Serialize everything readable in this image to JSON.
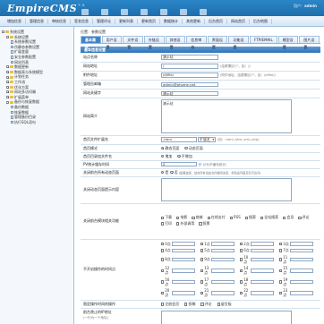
{
  "header": {
    "logo": "EmpireCMS",
    "logo_sup": "7.5",
    "user_label": "用户：",
    "user_name": "admin",
    "nav": [
      "系统",
      "栏目",
      "信息",
      "会员",
      "插件",
      "用户",
      "其他"
    ],
    "subnav": [
      "增加信息",
      "管理信息",
      "审核信息",
      "签发信息",
      "管理评论",
      "更新列表",
      "更新首页",
      "数据统计",
      "其他更新",
      "后台首页",
      "网站首页",
      "后台地图"
    ]
  },
  "sidebar": {
    "items": [
      {
        "label": "系统设置",
        "level": 0,
        "kind": "folder",
        "mark": "-"
      },
      {
        "label": "系统设置",
        "level": 1,
        "kind": "folder",
        "mark": "-"
      },
      {
        "label": "系统参数设置",
        "level": 2,
        "kind": "doc"
      },
      {
        "label": "伪静态参数设置",
        "level": 2,
        "kind": "doc"
      },
      {
        "label": "扩展变量",
        "level": 2,
        "kind": "doc"
      },
      {
        "label": "安全参数配置",
        "level": 2,
        "kind": "doc"
      },
      {
        "label": "网站列表",
        "level": 2,
        "kind": "doc"
      },
      {
        "label": "数据更新",
        "level": 1,
        "kind": "folder",
        "mark": "+"
      },
      {
        "label": "数据表与系统模型",
        "level": 1,
        "kind": "folder",
        "mark": "+"
      },
      {
        "label": "计划任务",
        "level": 1,
        "kind": "folder",
        "mark": "+"
      },
      {
        "label": "工作流",
        "level": 1,
        "kind": "folder",
        "mark": "+"
      },
      {
        "label": "优化方案",
        "level": 1,
        "kind": "folder",
        "mark": "+"
      },
      {
        "label": "网站多访问端",
        "level": 1,
        "kind": "folder",
        "mark": "+"
      },
      {
        "label": "扩展菜单",
        "level": 1,
        "kind": "folder",
        "mark": "+"
      },
      {
        "label": "备份与恢复数据",
        "level": 1,
        "kind": "folder",
        "mark": "-"
      },
      {
        "label": "备份数据",
        "level": 2,
        "kind": "doc"
      },
      {
        "label": "恢复数据",
        "level": 2,
        "kind": "doc"
      },
      {
        "label": "管理备份目录",
        "level": 2,
        "kind": "doc"
      },
      {
        "label": "执行SQL语句",
        "level": 2,
        "kind": "doc"
      }
    ]
  },
  "main": {
    "breadcrumb": "位置：参数设置",
    "tabs": [
      "基本属性",
      "用户设置",
      "文件设置",
      "外链设置",
      "其他设置",
      "信息审核",
      "界面设置",
      "功能设置",
      "FTP/EMAIL",
      "模型设置",
      "图片设置"
    ],
    "section_title": "基本信息设置",
    "fields": {
      "site_name_label": "站点名称",
      "site_name_value": "演示站",
      "site_url_label": "网站地址",
      "site_url_value": "/",
      "site_url_note": "(结尾需加\"/\"，如：/)",
      "attach_url_label": "附件地址",
      "attach_url_value": "/d/file/",
      "attach_url_note": "(附件地址，结尾需加\"/\"，如：/d/file/)",
      "admin_email_label": "管理员邮箱",
      "admin_email_value": "admin@phome.net",
      "keywords_label": "网站关键字",
      "keywords_value": "演示站",
      "description_label": "网站简介",
      "description_value": "演示站",
      "index_ext_label": "首页文件扩展名",
      "index_ext_value": ".html",
      "index_ext_select": "扩展名",
      "index_ext_note": "(如：.html,.htm,.xml,.php)",
      "index_mode_label": "首页模式",
      "index_mode_options": [
        "静态页面",
        "动态页面"
      ],
      "index_dir_label": "首页目录加文件名",
      "index_dir_options": [
        "增加",
        "不增加"
      ],
      "pv_label": "PV统计缓存时间",
      "pv_value": "0",
      "pv_note": "秒 (0为不缓存统计)",
      "close_label": "关闭前台所有动态页面",
      "close_options": [
        "是",
        "否"
      ],
      "close_note": "(如果选择，前台所有动态文件都将关闭，但信息列表页仍可访问)",
      "close_msg_label": "关闭动态页面提示内容",
      "close_modules_label": "关闭前台模块相关功能",
      "close_modules_options": [
        "下载",
        "电影",
        "商城",
        "在线支付",
        "RSS",
        "搜索",
        "全站搜索",
        "会员",
        "评论",
        "打印",
        "外部调用",
        "投票"
      ],
      "open_hours_label": "不开启操作的时间点",
      "hours": [
        "0点",
        "1点",
        "2点",
        "3点",
        "4点",
        "5点",
        "6点",
        "7点",
        "8点",
        "9点",
        "10点",
        "11点",
        "12点",
        "13点",
        "14点",
        "15点",
        "16点",
        "17点",
        "18点",
        "19点",
        "20点",
        "21点",
        "22点",
        "23点"
      ],
      "limit_label": "限定操作时间的操作",
      "limit_options": [
        "注册会员",
        "投稿",
        "评论",
        "留言板"
      ],
      "ip_label": "前台禁止的IP地址",
      "ip_note": "(一行为一个地址)"
    }
  }
}
